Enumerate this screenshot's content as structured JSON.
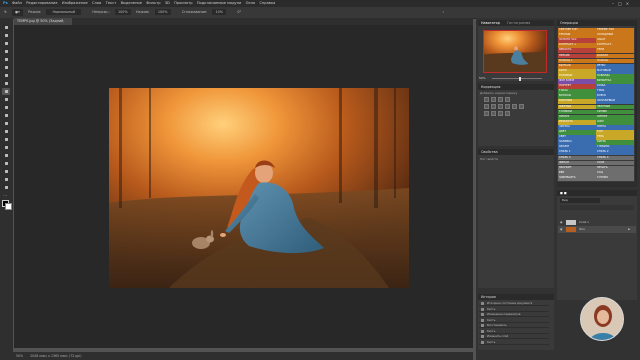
{
  "menu": [
    "Файл",
    "Редактирование",
    "Изображение",
    "Слои",
    "Текст",
    "Выделение",
    "Фильтр",
    "3D",
    "Просмотр",
    "Подключаемые модули",
    "Окно",
    "Справка"
  ],
  "options": {
    "mode_label": "Режим:",
    "mode_value": "Нормальный",
    "opacity_label": "Непрозр.:",
    "opacity_value": "100%",
    "flow_label": "Нажим:",
    "flow_value": "100%",
    "smooth_label": "Сглаживание:",
    "smooth_value": "10%",
    "angle_value": "0°"
  },
  "document": {
    "tab_title": "TEMP0.jpg @ 50% (Задний, RGB/8) *",
    "status_zoom": "50%",
    "status_info": "2048 пикс x 1365 пикс (72 ppi)"
  },
  "panels": {
    "navigator": {
      "tabs": [
        "Навигатор",
        "Гистограмма"
      ],
      "zoom": "50%"
    },
    "adjustments": {
      "title": "Коррекция",
      "subtitle": "Добавить корректировку"
    },
    "properties": {
      "title": "Свойства",
      "empty": "Нет свойств"
    },
    "history": {
      "title": "История",
      "items": [
        "Исходное состояние документа",
        "Кисть",
        "Изменение параметров",
        "Кисть",
        "Восстановить",
        "Кисть",
        "Изменить слой",
        "Кисть"
      ]
    },
    "actions": {
      "title": "Операции",
      "rows": [
        [
          "СВЕТЛЕЕ ТОН",
          "ТЕМНЕЕ ТОН"
        ],
        [
          "ТЁПЛЫЙ",
          "ХОЛОДНЫЙ"
        ],
        [
          "ЗОЛОТО ЧАС",
          "ЗАКАТ"
        ],
        [
          "КОНТРАСТ +",
          "КОНТРАСТ -"
        ],
        [
          "ЯРКОСТЬ",
          "ТЕНИ"
        ],
        [
          "ПЕРСИК",
          "КОРАЛЛ"
        ],
        [
          "НАСЫЩ +",
          "НАСЫЩ -"
        ],
        [
          "ВИНТАЖ",
          "РЕТРО"
        ],
        [
          "КИНО",
          "МАТОВЫЙ"
        ],
        [
          "РОЗОВЫЙ",
          "ЛАВАНДА"
        ],
        [
          "ФОН БЛЮР",
          "ВИНЬЕТКА"
        ],
        [
          "ПОРТРЕТ",
          "КОЖА"
        ],
        [
          "ГЛАЗА",
          "ГУБЫ"
        ],
        [
          "ВОЛОСЫ",
          "БЛЕСК"
        ],
        [
          "КРАСНЫЙ",
          "ОРАНЖЕВЫЙ"
        ],
        [
          "ЖЁЛТЫЙ",
          "ЗЕЛЁНЫЙ"
        ],
        [
          "ГОЛУБОЙ",
          "СИНИЙ"
        ],
        [
          "ПУРПУР",
          "ПУРПУР"
        ],
        [
          "РЕЗКОСТЬ",
          "ШУМ"
        ],
        [
          "ЧИСТКА",
          "ПЯТНА"
        ],
        [
          "ЦВЕТ",
          "ТОН"
        ],
        [
          "СВЕТ",
          "ТЕНЬ"
        ],
        [
          "ЗАЛИВКА",
          "КИСТЬ"
        ],
        [
          "ОБЪЁМ",
          "ГЛУБИНА"
        ],
        [
          "СТИЛЬ 1",
          "СТИЛЬ 2"
        ],
        [
          "СТИЛЬ 3",
          "СТИЛЬ 4"
        ],
        [
          "ФИНАЛ",
          "СОХР"
        ],
        [
          "ЭКСПОРТ",
          "ПЕЧАТЬ"
        ],
        [
          "ВЕБ",
          "СОЦ"
        ],
        [
          "ЗАВЕРШИТЬ",
          "ГОТОВО"
        ]
      ]
    },
    "layers": {
      "search": "Вид",
      "items": [
        "Слой 1",
        "Фон"
      ]
    }
  },
  "colors": {
    "orange": "#c9771a",
    "red": "#b8403a",
    "yellow": "#c9a827",
    "green": "#3f8f3d",
    "blue": "#3a6db0",
    "violet": "#7a4da8",
    "gray": "#6e6e6e"
  }
}
